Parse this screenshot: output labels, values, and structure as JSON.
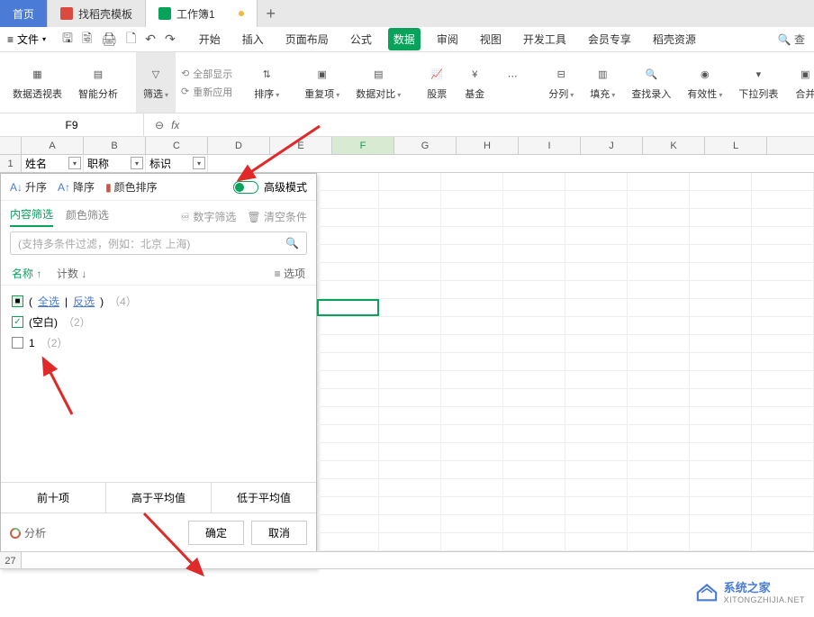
{
  "tabs": {
    "home": "首页",
    "template": "找稻壳模板",
    "workbook": "工作簿1"
  },
  "menu": {
    "file": "文件",
    "items": [
      "开始",
      "插入",
      "页面布局",
      "公式",
      "数据",
      "审阅",
      "视图",
      "开发工具",
      "会员专享",
      "稻壳资源"
    ],
    "activeIndex": 4
  },
  "ribbon": {
    "pivot": "数据透视表",
    "smart": "智能分析",
    "filter": "筛选",
    "showAll": "全部显示",
    "reapply": "重新应用",
    "sort": "排序",
    "dup": "重复项",
    "compare": "数据对比",
    "stock": "股票",
    "fund": "基金",
    "split": "分列",
    "fill": "填充",
    "lookup": "查找录入",
    "validate": "有效性",
    "dropdown": "下拉列表",
    "merge": "合并"
  },
  "formulaBar": {
    "cell": "F9",
    "fx": "fx"
  },
  "columns": [
    "A",
    "B",
    "C",
    "D",
    "E",
    "F",
    "G",
    "H",
    "I",
    "J",
    "K",
    "L"
  ],
  "selectedCol": "F",
  "row1": {
    "num": "1",
    "A": "姓名",
    "B": "职称",
    "C": "标识"
  },
  "filterPanel": {
    "asc": "升序",
    "desc": "降序",
    "colorSort": "颜色排序",
    "advanced": "高级模式",
    "tabContent": "内容筛选",
    "tabColor": "颜色筛选",
    "numFilter": "数字筛选",
    "clear": "清空条件",
    "searchPlaceholder": "(支持多条件过滤，例如：北京  上海)",
    "colName": "名称 ↑",
    "colCount": "计数 ↓",
    "options": "选项",
    "selectAll": "全选",
    "invert": "反选",
    "allCount": "（4）",
    "blank": "(空白)",
    "blankCount": "（2）",
    "val1": "1",
    "val1Count": "（2）",
    "top10": "前十项",
    "aboveAvg": "高于平均值",
    "belowAvg": "低于平均值",
    "analyze": "分析",
    "ok": "确定",
    "cancel": "取消"
  },
  "rowBottom": "27",
  "watermark": {
    "title": "系统之家",
    "url": "XITONGZHIJIA.NET"
  }
}
